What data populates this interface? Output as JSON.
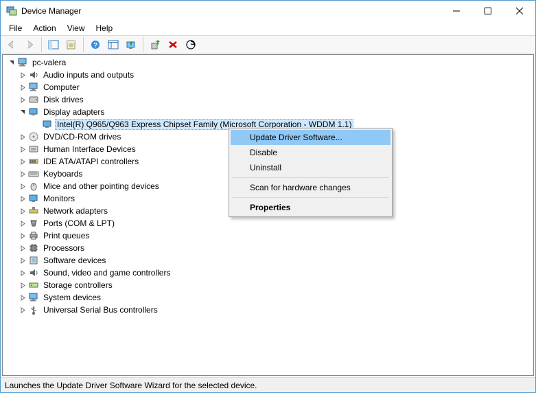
{
  "window": {
    "title": "Device Manager"
  },
  "menu": {
    "file": "File",
    "action": "Action",
    "view": "View",
    "help": "Help"
  },
  "root": "pc-valera",
  "categories": {
    "audio": "Audio inputs and outputs",
    "computer": "Computer",
    "disk": "Disk drives",
    "display": "Display adapters",
    "display_child": "Intel(R)  Q965/Q963 Express Chipset Family (Microsoft Corporation - WDDM 1.1)",
    "dvd": "DVD/CD-ROM drives",
    "hid": "Human Interface Devices",
    "ide": "IDE ATA/ATAPI controllers",
    "keyboards": "Keyboards",
    "mice": "Mice and other pointing devices",
    "monitors": "Monitors",
    "network": "Network adapters",
    "ports": "Ports (COM & LPT)",
    "printq": "Print queues",
    "processors": "Processors",
    "software": "Software devices",
    "sound": "Sound, video and game controllers",
    "storage": "Storage controllers",
    "system": "System devices",
    "usb": "Universal Serial Bus controllers"
  },
  "ctx": {
    "update": "Update Driver Software...",
    "disable": "Disable",
    "uninstall": "Uninstall",
    "scan": "Scan for hardware changes",
    "properties": "Properties"
  },
  "status": "Launches the Update Driver Software Wizard for the selected device."
}
